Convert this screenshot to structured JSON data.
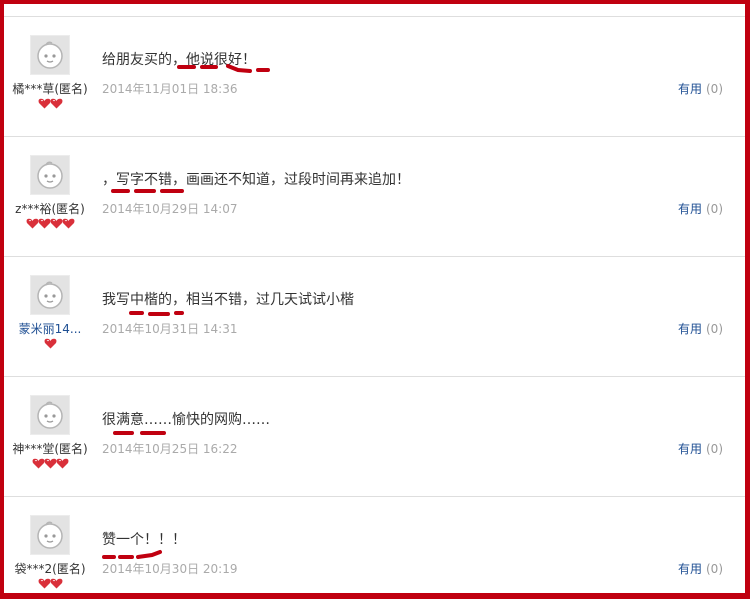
{
  "reviews": [
    {
      "user": "橘***草(匿名)",
      "user_is_link": false,
      "badge_count": 2,
      "content": "给朋友买的，他说很好！",
      "date": "2014年11月01日 18:36",
      "useful_label": "有用",
      "useful_count": "(0)"
    },
    {
      "user": "z***裕(匿名)",
      "user_is_link": false,
      "badge_count": 4,
      "content": "，写字不错，画画还不知道，过段时间再来追加！",
      "date": "2014年10月29日 14:07",
      "useful_label": "有用",
      "useful_count": "(0)"
    },
    {
      "user": "蒙米丽14...",
      "user_is_link": true,
      "badge_count": 1,
      "content": "我写中楷的，相当不错，过几天试试小楷",
      "date": "2014年10月31日 14:31",
      "useful_label": "有用",
      "useful_count": "(0)"
    },
    {
      "user": "神***堂(匿名)",
      "user_is_link": false,
      "badge_count": 3,
      "content": "很满意……愉快的网购……",
      "date": "2014年10月25日 16:22",
      "useful_label": "有用",
      "useful_count": "(0)"
    },
    {
      "user": "袋***2(匿名)",
      "user_is_link": false,
      "badge_count": 2,
      "content": "赞一个！！！",
      "date": "2014年10月30日 20:19",
      "useful_label": "有用",
      "useful_count": "(0)"
    }
  ],
  "colors": {
    "frame": "#c00010",
    "annotation": "#c00010",
    "link": "#1f4f93",
    "badge": "#d9303a"
  },
  "icons": {
    "avatar": "default-avatar-face-icon",
    "badge": "red-heart-badge-icon"
  }
}
